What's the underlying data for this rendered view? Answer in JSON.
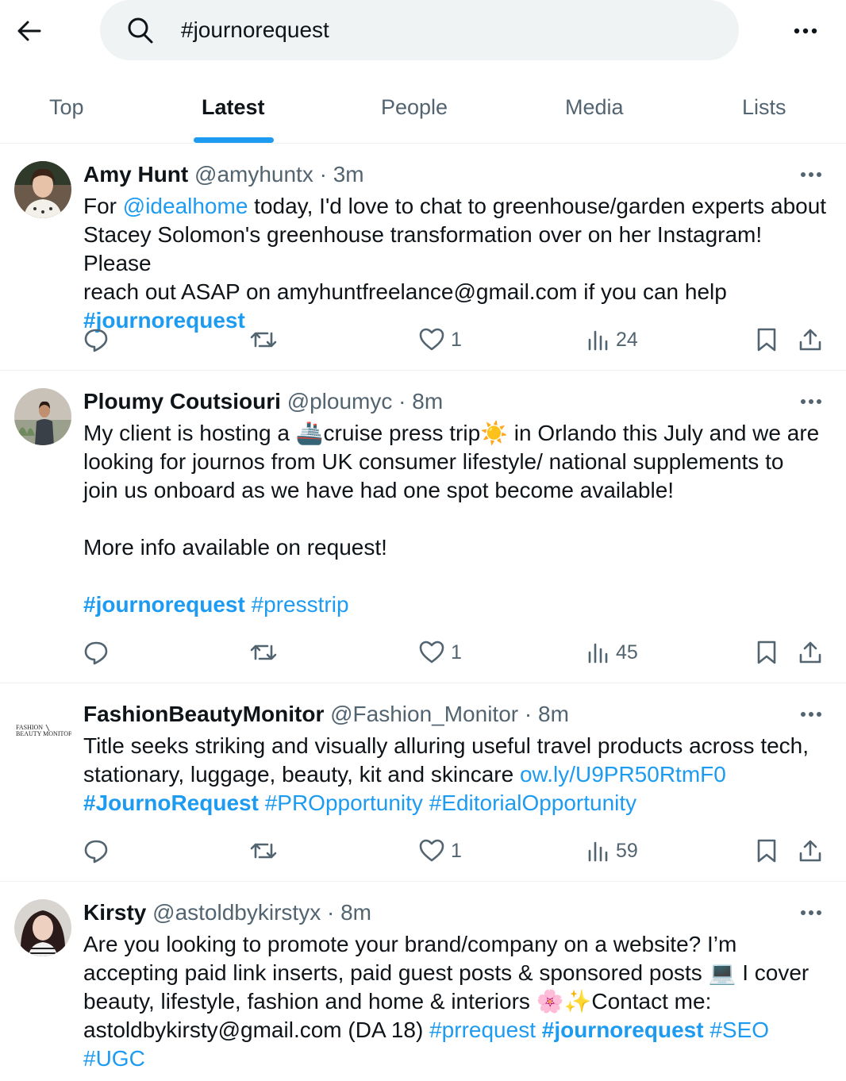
{
  "search": {
    "query": "#journorequest"
  },
  "tabs": [
    {
      "label": "Top"
    },
    {
      "label": "Latest"
    },
    {
      "label": "People"
    },
    {
      "label": "Media"
    },
    {
      "label": "Lists"
    }
  ],
  "colors": {
    "accent": "#1d9bf0",
    "muted": "#536471",
    "text": "#0f1419",
    "search_bg": "#eff3f4"
  },
  "tweets": [
    {
      "name": "Amy Hunt",
      "handle": "@amyhuntx",
      "time": "3m",
      "body": {
        "p1": "For ",
        "mention": "@idealhome",
        "p2": " today, I'd love to chat to greenhouse/garden experts about\nStacey Solomon's greenhouse transformation over on her Instagram! Please\nreach out ASAP on amyhuntfreelance@gmail.com if you can help\n",
        "tag1": "#journorequest"
      },
      "likes": "1",
      "views": "24"
    },
    {
      "name": "Ploumy Coutsiouri",
      "handle": "@ploumyc",
      "time": "8m",
      "body": {
        "p1": "My client is hosting a 🚢cruise press trip☀️ in Orlando this July and we are\nlooking for journos from UK consumer lifestyle/ national supplements to\njoin us onboard as we have had one spot become available!\n\nMore info available on request!\n\n",
        "tag1": "#journorequest",
        "tag2": " #presstrip"
      },
      "likes": "1",
      "views": "45"
    },
    {
      "name": "FashionBeautyMonitor",
      "handle": "@Fashion_Monitor",
      "time": "8m",
      "logo_text": "FASHION BEAUTY MONITOR",
      "body": {
        "p1": "Title seeks striking and visually alluring useful travel products across tech,\nstationary, luggage, beauty, kit and skincare ",
        "link": "ow.ly/U9PR50RtmF0",
        "tag1": "#JournoRequest",
        "tag2": " #PROpportunity #EditorialOpportunity"
      },
      "likes": "1",
      "views": "59"
    },
    {
      "name": "Kirsty",
      "handle": "@astoldbykirstyx",
      "time": "8m",
      "body": {
        "p1": "Are you looking to promote your brand/company on a website? I’m\naccepting paid link inserts, paid guest posts & sponsored posts 💻 I cover\nbeauty, lifestyle, fashion and home & interiors 🌸✨Contact me:\nastoldbykirsty@gmail.com (DA 18) ",
        "tag0": "#prrequest ",
        "tag1": "#journorequest",
        "tag2": " #SEO\n#UGC"
      }
    }
  ]
}
